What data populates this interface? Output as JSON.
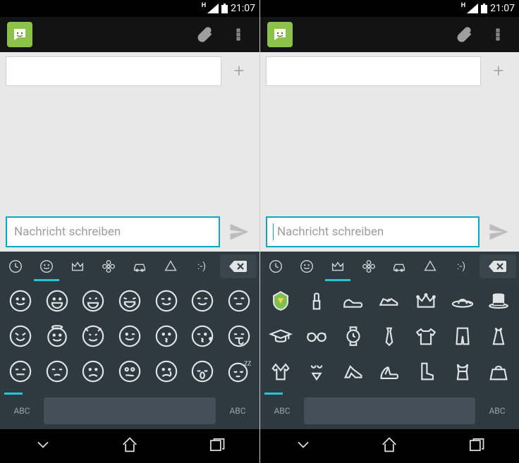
{
  "status": {
    "time": "21:07",
    "network_label": "H"
  },
  "compose": {
    "placeholder": "Nachricht schreiben"
  },
  "keyboard": {
    "abc_label": "ABC",
    "tabs": [
      "recent",
      "smileys",
      "crown",
      "flower",
      "car",
      "triangle",
      "text"
    ],
    "backspace_glyph": "✕",
    "text_emoticon": ":-)"
  },
  "left": {
    "active_tab": 1,
    "emoji_names": [
      "smile",
      "grin",
      "big-grin",
      "laugh-tears",
      "wink",
      "blush",
      "smile-closed",
      "laugh",
      "angel",
      "devil",
      "wink2",
      "kiss",
      "kiss-heart",
      "tongue",
      "neutral",
      "unamused",
      "sad",
      "confused",
      "cry",
      "sleepy",
      "zzz"
    ]
  },
  "right": {
    "active_tab": 2,
    "emoji_names": [
      "badge",
      "lipstick",
      "mens-shoe",
      "sneaker",
      "crown",
      "sun-hat",
      "top-hat",
      "grad-cap",
      "glasses",
      "watch",
      "necktie",
      "tshirt",
      "jeans",
      "dress",
      "kimono",
      "bikini",
      "high-heel",
      "sandal",
      "boot",
      "womans-clothes",
      "handbag"
    ]
  }
}
